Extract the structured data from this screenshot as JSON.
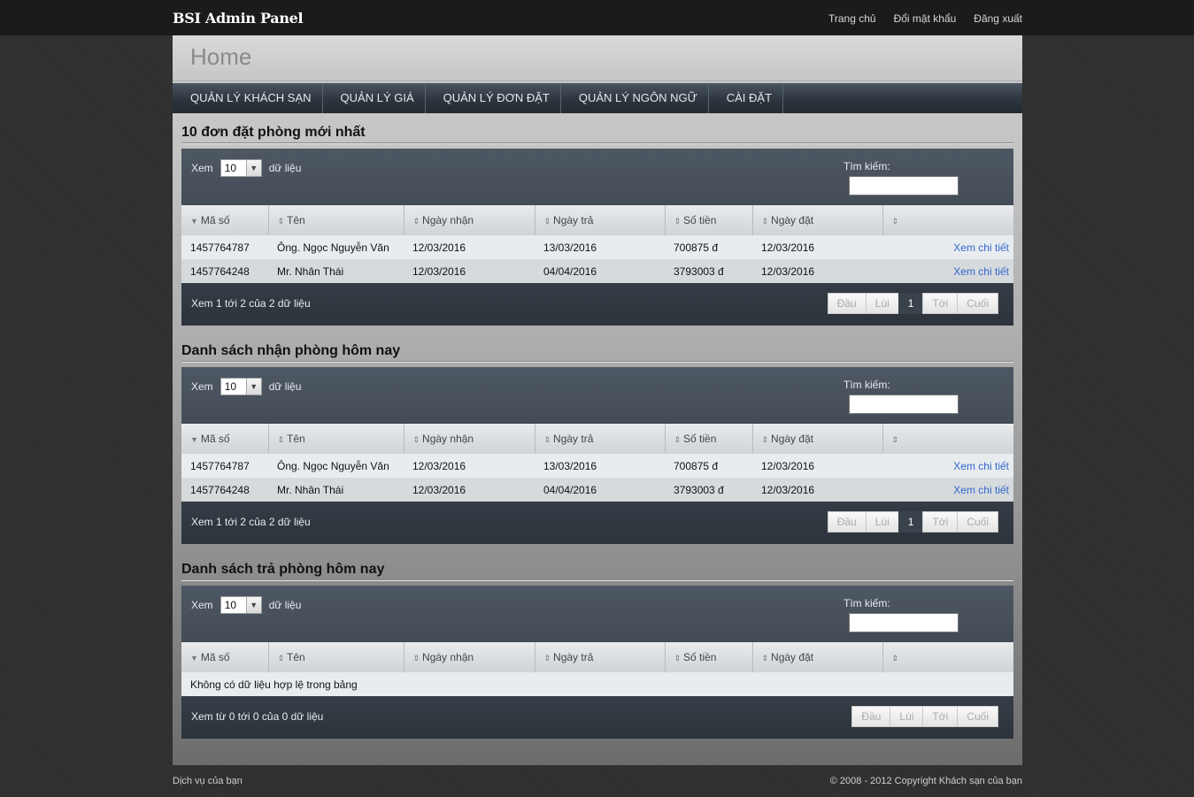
{
  "brand": "BSI Admin Panel",
  "top_links": [
    "Trang chủ",
    "Đổi mật khẩu",
    "Đăng xuất"
  ],
  "page_title": "Home",
  "nav": [
    "QUẢN LÝ KHÁCH SẠN",
    "QUẢN LÝ GIÁ",
    "QUẢN LÝ ĐƠN ĐẶT",
    "QUẢN LÝ NGÔN NGỮ",
    "CÀI ĐẶT"
  ],
  "common": {
    "show_label": "Xem",
    "show_value": "10",
    "records_label": "dữ liệu",
    "search_label": "Tìm kiếm:",
    "columns": [
      "Mã số",
      "Tên",
      "Ngày nhận",
      "Ngày trả",
      "Số tiền",
      "Ngày đặt",
      ""
    ],
    "detail_link": "Xem chi tiết",
    "pager": {
      "first": "Đầu",
      "prev": "Lùi",
      "page": "1",
      "next": "Tới",
      "last": "Cuối"
    }
  },
  "sections": [
    {
      "title": "10 đơn đặt phòng mới nhất",
      "rows": [
        [
          "1457764787",
          "Ông. Ngọc Nguyễn Văn",
          "12/03/2016",
          "13/03/2016",
          "700875 đ",
          "12/03/2016"
        ],
        [
          "1457764248",
          "Mr. Nhân Thái",
          "12/03/2016",
          "04/04/2016",
          "3793003 đ",
          "12/03/2016"
        ]
      ],
      "info": "Xem 1 tới 2 của 2 dữ liệu"
    },
    {
      "title": "Danh sách nhận phòng hôm nay",
      "rows": [
        [
          "1457764787",
          "Ông. Ngọc Nguyễn Văn",
          "12/03/2016",
          "13/03/2016",
          "700875 đ",
          "12/03/2016"
        ],
        [
          "1457764248",
          "Mr. Nhân Thái",
          "12/03/2016",
          "04/04/2016",
          "3793003 đ",
          "12/03/2016"
        ]
      ],
      "info": "Xem 1 tới 2 của 2 dữ liệu"
    },
    {
      "title": "Danh sách trả phòng hôm nay",
      "rows": [],
      "empty_text": "Không có dữ liệu hợp lệ trong bảng",
      "info": "Xem từ 0 tới 0 của 0 dữ liệu"
    }
  ],
  "footer": {
    "left": "Dịch vụ của bạn",
    "right": "© 2008 - 2012 Copyright Khách sạn của bạn"
  }
}
